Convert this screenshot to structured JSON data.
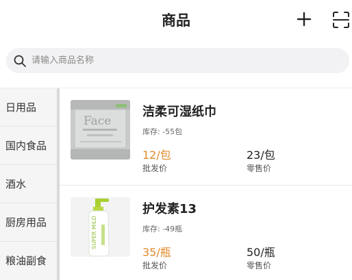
{
  "header": {
    "title": "商品"
  },
  "search": {
    "placeholder": "请输入商品名称"
  },
  "sidebar": {
    "items": [
      {
        "label": "日用品"
      },
      {
        "label": "国内食品"
      },
      {
        "label": "酒水"
      },
      {
        "label": "厨房用品"
      },
      {
        "label": "粮油副食"
      }
    ]
  },
  "products": [
    {
      "name": "洁柔可湿纸巾",
      "stock": "库存: -55包",
      "wholesale_price": "12/包",
      "wholesale_label": "批发价",
      "retail_price": "23/包",
      "retail_label": "零售价",
      "image_text": "Face"
    },
    {
      "name": "护发素13",
      "stock": "库存: -49瓶",
      "wholesale_price": "35/瓶",
      "wholesale_label": "批发价",
      "retail_price": "50/瓶",
      "retail_label": "零售价",
      "image_text": "SUPER MILD"
    }
  ],
  "colors": {
    "accent": "#e08a2a",
    "sidebar_bg": "#f5f5f6"
  }
}
